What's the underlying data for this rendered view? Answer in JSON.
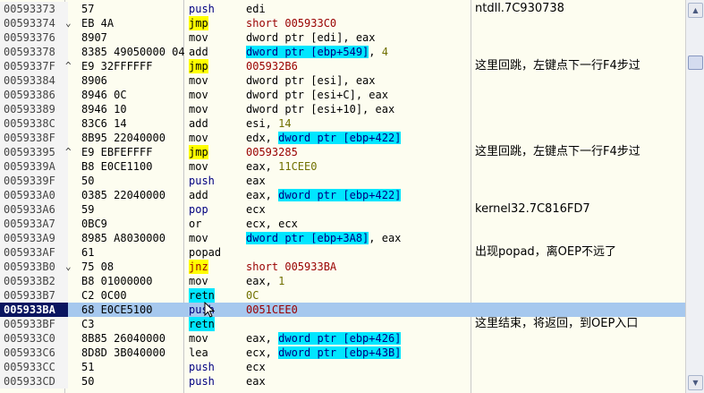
{
  "rows": [
    {
      "addr": "00593373",
      "mark": "",
      "hex": "57",
      "mn": "push",
      "mn_hl": "",
      "mn_color": "navy",
      "ops": [
        {
          "t": "edi",
          "c": ""
        }
      ],
      "cmt": "ntdll.7C930738"
    },
    {
      "addr": "00593374",
      "mark": "⌄",
      "hex": "EB 4A",
      "mn": "jmp",
      "mn_hl": "yellow",
      "mn_color": "",
      "ops": [
        {
          "t": "short 005933C0",
          "c": "red"
        }
      ],
      "cmt": ""
    },
    {
      "addr": "00593376",
      "mark": "",
      "hex": "8907",
      "mn": "mov",
      "mn_hl": "",
      "mn_color": "",
      "ops": [
        {
          "t": "dword ptr [edi], eax",
          "c": ""
        }
      ],
      "cmt": ""
    },
    {
      "addr": "00593378",
      "mark": "",
      "hex": "8385 49050000 04",
      "mn": "add",
      "mn_hl": "",
      "mn_color": "",
      "ops": [
        {
          "t": "dword ptr [ebp+549]",
          "c": "cyanblue"
        },
        {
          "t": ", ",
          "c": ""
        },
        {
          "t": "4",
          "c": "num"
        }
      ],
      "cmt": ""
    },
    {
      "addr": "0059337F",
      "mark": "^",
      "hex": "E9 32FFFFFF",
      "mn": "jmp",
      "mn_hl": "yellow",
      "mn_color": "",
      "ops": [
        {
          "t": "005932B6",
          "c": "red"
        }
      ],
      "cmt": "这里回跳，左键点下一行F4步过"
    },
    {
      "addr": "00593384",
      "mark": "",
      "hex": "8906",
      "mn": "mov",
      "mn_hl": "",
      "mn_color": "",
      "ops": [
        {
          "t": "dword ptr [esi], eax",
          "c": ""
        }
      ],
      "cmt": ""
    },
    {
      "addr": "00593386",
      "mark": "",
      "hex": "8946 0C",
      "mn": "mov",
      "mn_hl": "",
      "mn_color": "",
      "ops": [
        {
          "t": "dword ptr [esi+C], eax",
          "c": ""
        }
      ],
      "cmt": ""
    },
    {
      "addr": "00593389",
      "mark": "",
      "hex": "8946 10",
      "mn": "mov",
      "mn_hl": "",
      "mn_color": "",
      "ops": [
        {
          "t": "dword ptr [esi+10], eax",
          "c": ""
        }
      ],
      "cmt": ""
    },
    {
      "addr": "0059338C",
      "mark": "",
      "hex": "83C6 14",
      "mn": "add",
      "mn_hl": "",
      "mn_color": "",
      "ops": [
        {
          "t": "esi, ",
          "c": ""
        },
        {
          "t": "14",
          "c": "num"
        }
      ],
      "cmt": ""
    },
    {
      "addr": "0059338F",
      "mark": "",
      "hex": "8B95 22040000",
      "mn": "mov",
      "mn_hl": "",
      "mn_color": "",
      "ops": [
        {
          "t": "edx, ",
          "c": ""
        },
        {
          "t": "dword ptr [ebp+422]",
          "c": "cyanblue"
        }
      ],
      "cmt": ""
    },
    {
      "addr": "00593395",
      "mark": "^",
      "hex": "E9 EBFEFFFF",
      "mn": "jmp",
      "mn_hl": "yellow",
      "mn_color": "",
      "ops": [
        {
          "t": "00593285",
          "c": "red"
        }
      ],
      "cmt": "这里回跳，左键点下一行F4步过"
    },
    {
      "addr": "0059339A",
      "mark": "",
      "hex": "B8 E0CE1100",
      "mn": "mov",
      "mn_hl": "",
      "mn_color": "",
      "ops": [
        {
          "t": "eax, ",
          "c": ""
        },
        {
          "t": "11CEE0",
          "c": "num"
        }
      ],
      "cmt": ""
    },
    {
      "addr": "0059339F",
      "mark": "",
      "hex": "50",
      "mn": "push",
      "mn_hl": "",
      "mn_color": "navy",
      "ops": [
        {
          "t": "eax",
          "c": ""
        }
      ],
      "cmt": ""
    },
    {
      "addr": "005933A0",
      "mark": "",
      "hex": "0385 22040000",
      "mn": "add",
      "mn_hl": "",
      "mn_color": "",
      "ops": [
        {
          "t": "eax, ",
          "c": ""
        },
        {
          "t": "dword ptr [ebp+422]",
          "c": "cyanblue"
        }
      ],
      "cmt": ""
    },
    {
      "addr": "005933A6",
      "mark": "",
      "hex": "59",
      "mn": "pop",
      "mn_hl": "",
      "mn_color": "navy",
      "ops": [
        {
          "t": "ecx",
          "c": ""
        }
      ],
      "cmt": "kernel32.7C816FD7"
    },
    {
      "addr": "005933A7",
      "mark": "",
      "hex": "0BC9",
      "mn": "or",
      "mn_hl": "",
      "mn_color": "",
      "ops": [
        {
          "t": "ecx, ecx",
          "c": ""
        }
      ],
      "cmt": ""
    },
    {
      "addr": "005933A9",
      "mark": "",
      "hex": "8985 A8030000",
      "mn": "mov",
      "mn_hl": "",
      "mn_color": "",
      "ops": [
        {
          "t": "dword ptr [ebp+3A8]",
          "c": "cyanblue"
        },
        {
          "t": ", eax",
          "c": ""
        }
      ],
      "cmt": ""
    },
    {
      "addr": "005933AF",
      "mark": "",
      "hex": "61",
      "mn": "popad",
      "mn_hl": "",
      "mn_color": "",
      "ops": [],
      "cmt": "出现popad，离OEP不远了"
    },
    {
      "addr": "005933B0",
      "mark": "⌄",
      "hex": "75 08",
      "mn": "jnz",
      "mn_hl": "yellow",
      "mn_color": "red",
      "ops": [
        {
          "t": "short 005933BA",
          "c": "red"
        }
      ],
      "cmt": ""
    },
    {
      "addr": "005933B2",
      "mark": "",
      "hex": "B8 01000000",
      "mn": "mov",
      "mn_hl": "",
      "mn_color": "",
      "ops": [
        {
          "t": "eax, ",
          "c": ""
        },
        {
          "t": "1",
          "c": "num"
        }
      ],
      "cmt": ""
    },
    {
      "addr": "005933B7",
      "mark": "",
      "hex": "C2 0C00",
      "mn": "retn",
      "mn_hl": "cyan",
      "mn_color": "",
      "ops": [
        {
          "t": "0C",
          "c": "num"
        }
      ],
      "cmt": ""
    },
    {
      "addr": "005933BA",
      "mark": "",
      "hex": "68 E0CE5100",
      "mn": "push",
      "mn_hl": "",
      "mn_color": "navy",
      "ops": [
        {
          "t": "0051CEE0",
          "c": "red"
        }
      ],
      "cmt": "",
      "selected": true
    },
    {
      "addr": "005933BF",
      "mark": "",
      "hex": "C3",
      "mn": "retn",
      "mn_hl": "cyan",
      "mn_color": "",
      "ops": [],
      "cmt": "这里结束，将返回，到OEP入口"
    },
    {
      "addr": "005933C0",
      "mark": "",
      "hex": "8B85 26040000",
      "mn": "mov",
      "mn_hl": "",
      "mn_color": "",
      "ops": [
        {
          "t": "eax, ",
          "c": ""
        },
        {
          "t": "dword ptr [ebp+426]",
          "c": "cyanblue"
        }
      ],
      "cmt": ""
    },
    {
      "addr": "005933C6",
      "mark": "",
      "hex": "8D8D 3B040000",
      "mn": "lea",
      "mn_hl": "",
      "mn_color": "",
      "ops": [
        {
          "t": "ecx, ",
          "c": ""
        },
        {
          "t": "dword ptr [ebp+43B]",
          "c": "cyanblue"
        }
      ],
      "cmt": ""
    },
    {
      "addr": "005933CC",
      "mark": "",
      "hex": "51",
      "mn": "push",
      "mn_hl": "",
      "mn_color": "navy",
      "ops": [
        {
          "t": "ecx",
          "c": ""
        }
      ],
      "cmt": ""
    },
    {
      "addr": "005933CD",
      "mark": "",
      "hex": "50",
      "mn": "push",
      "mn_hl": "",
      "mn_color": "navy",
      "ops": [
        {
          "t": "eax",
          "c": ""
        }
      ],
      "cmt": ""
    }
  ],
  "scrollbar": {
    "up_icon": "▲",
    "down_icon": "▼"
  }
}
